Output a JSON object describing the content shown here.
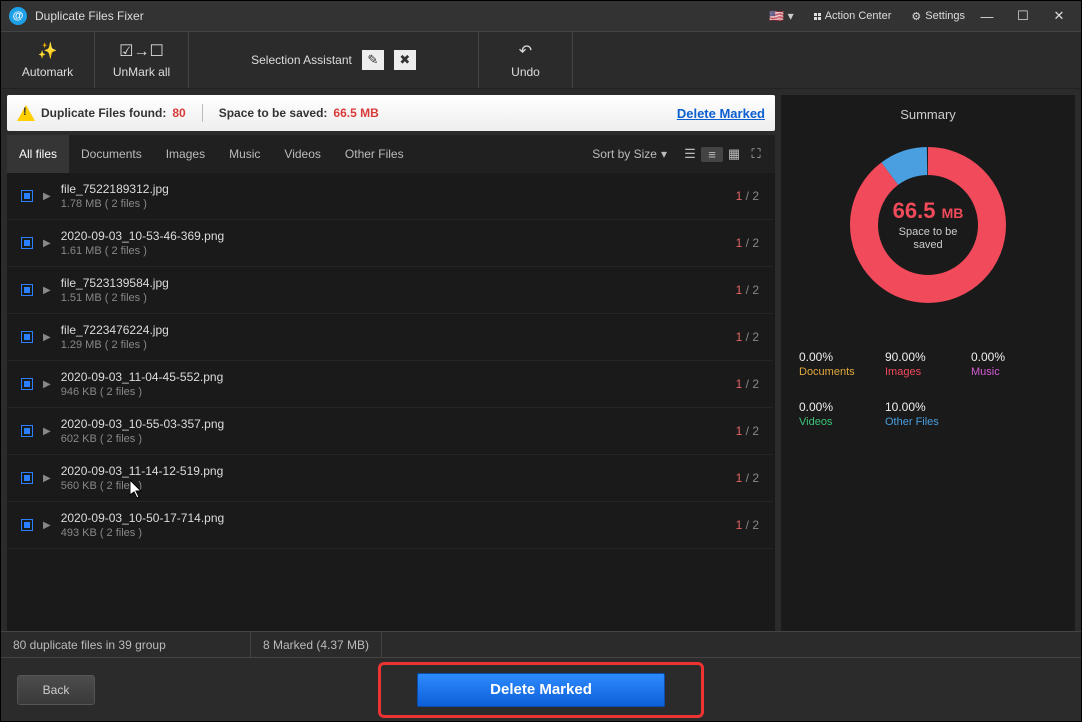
{
  "titlebar": {
    "app_name": "Duplicate Files Fixer",
    "action_center": "Action Center",
    "settings": "Settings"
  },
  "toolbar": {
    "automark": "Automark",
    "unmark_all": "UnMark all",
    "selection_assistant": "Selection Assistant",
    "undo": "Undo"
  },
  "banner": {
    "found_label": "Duplicate Files found:",
    "found_count": "80",
    "space_label": "Space to be saved:",
    "space_value": "66.5 MB",
    "delete_marked": "Delete Marked"
  },
  "tabs": [
    "All files",
    "Documents",
    "Images",
    "Music",
    "Videos",
    "Other Files"
  ],
  "sort_label": "Sort by Size",
  "files": [
    {
      "name": "file_7522189312.jpg",
      "meta": "1.78 MB  ( 2 files )",
      "sel": "1",
      "tot": "2"
    },
    {
      "name": "2020-09-03_10-53-46-369.png",
      "meta": "1.61 MB  ( 2 files )",
      "sel": "1",
      "tot": "2"
    },
    {
      "name": "file_7523139584.jpg",
      "meta": "1.51 MB  ( 2 files )",
      "sel": "1",
      "tot": "2"
    },
    {
      "name": "file_7223476224.jpg",
      "meta": "1.29 MB  ( 2 files )",
      "sel": "1",
      "tot": "2"
    },
    {
      "name": "2020-09-03_11-04-45-552.png",
      "meta": "946 KB  ( 2 files )",
      "sel": "1",
      "tot": "2"
    },
    {
      "name": "2020-09-03_10-55-03-357.png",
      "meta": "602 KB  ( 2 files )",
      "sel": "1",
      "tot": "2"
    },
    {
      "name": "2020-09-03_11-14-12-519.png",
      "meta": "560 KB  ( 2 files )",
      "sel": "1",
      "tot": "2"
    },
    {
      "name": "2020-09-03_10-50-17-714.png",
      "meta": "493 KB  ( 2 files )",
      "sel": "1",
      "tot": "2"
    }
  ],
  "status": {
    "groups": "80 duplicate files in 39 group",
    "marked": "8 Marked (4.37 MB)"
  },
  "buttons": {
    "back": "Back",
    "delete_marked": "Delete Marked"
  },
  "summary": {
    "title": "Summary",
    "value": "66.5",
    "unit": "MB",
    "sub": "Space to be saved",
    "stats": [
      {
        "pct": "0.00%",
        "label": "Documents",
        "cls": "c-doc"
      },
      {
        "pct": "90.00%",
        "label": "Images",
        "cls": "c-img"
      },
      {
        "pct": "0.00%",
        "label": "Music",
        "cls": "c-mus"
      },
      {
        "pct": "0.00%",
        "label": "Videos",
        "cls": "c-vid"
      },
      {
        "pct": "10.00%",
        "label": "Other Files",
        "cls": "c-oth"
      }
    ]
  },
  "chart_data": {
    "type": "pie",
    "title": "Space to be saved",
    "categories": [
      "Documents",
      "Images",
      "Music",
      "Videos",
      "Other Files"
    ],
    "values": [
      0,
      90,
      0,
      0,
      10
    ],
    "colors": [
      "#e0a83e",
      "#f14a5a",
      "#d65bd6",
      "#3bc47a",
      "#4a9fe0"
    ],
    "center_value": "66.5 MB"
  }
}
